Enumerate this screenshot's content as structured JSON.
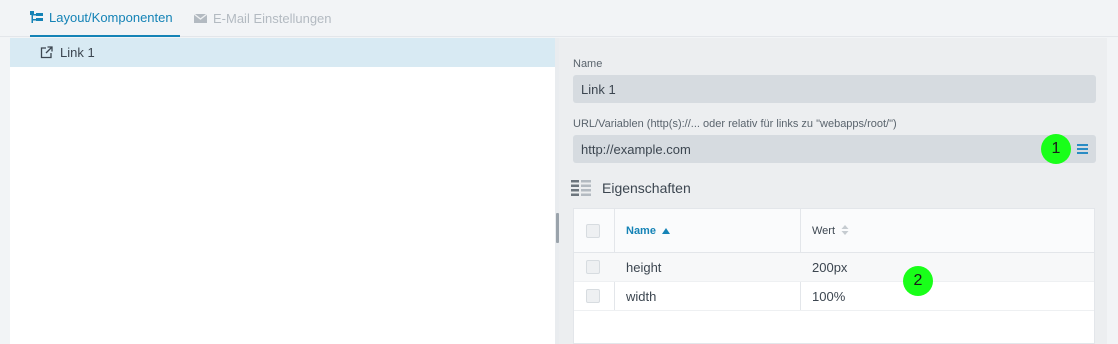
{
  "tabs": [
    {
      "label": "Layout/Komponenten",
      "icon": "tree-layout-icon",
      "active": true
    },
    {
      "label": "E-Mail Einstellungen",
      "icon": "envelope-icon",
      "active": false
    }
  ],
  "tree": {
    "items": [
      {
        "label": "Link 1",
        "icon": "external-link-icon",
        "selected": true
      }
    ]
  },
  "form": {
    "name_label": "Name",
    "name_value": "Link 1",
    "url_label": "URL/Variablen (http(s)://... oder relativ für links zu \"webapps/root/\")",
    "url_value": "http://example.com",
    "url_menu_icon": "hamburger-menu-icon"
  },
  "annotations": {
    "badge1": "1",
    "badge2": "2"
  },
  "properties": {
    "title": "Eigenschaften",
    "columns": [
      {
        "label": "Name",
        "sort": "ascending"
      },
      {
        "label": "Wert",
        "sort": "none"
      }
    ],
    "rows": [
      {
        "name": "height",
        "value": "200px"
      },
      {
        "name": "width",
        "value": "100%"
      }
    ]
  },
  "colors": {
    "accent": "#1583b6",
    "selected_row": "#d8eaf3",
    "input_bg": "#d6dbe0",
    "badge": "#19ff19"
  }
}
